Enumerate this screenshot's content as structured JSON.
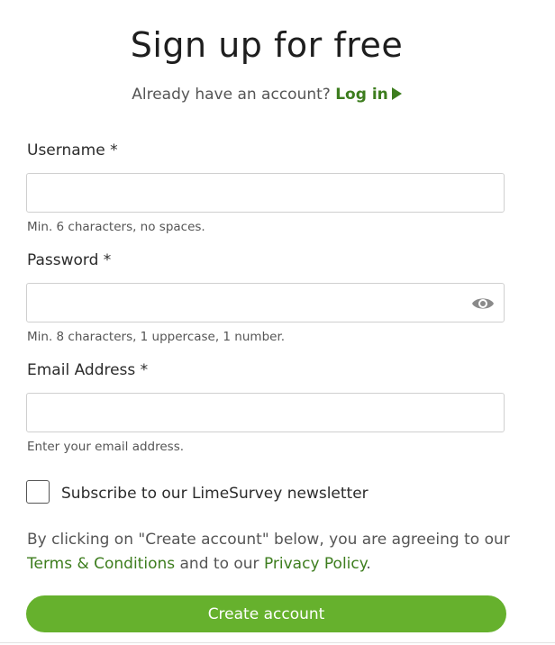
{
  "title": "Sign up for free",
  "login_prompt": {
    "text": "Already have an account?",
    "link_label": "Log in"
  },
  "fields": {
    "username": {
      "label": "Username *",
      "value": "",
      "help": "Min. 6 characters, no spaces."
    },
    "password": {
      "label": "Password *",
      "value": "",
      "help": "Min. 8 characters, 1 uppercase, 1 number.",
      "toggle_icon": "eye-icon"
    },
    "email": {
      "label": "Email Address *",
      "value": "",
      "help": "Enter your email address."
    }
  },
  "newsletter": {
    "label": "Subscribe to our LimeSurvey newsletter",
    "checked": false
  },
  "terms": {
    "prefix": "By clicking on \"Create account\" below, you are agreeing to our",
    "terms_link": "Terms & Conditions",
    "middle": "and to our",
    "privacy_link": "Privacy Policy",
    "suffix": "."
  },
  "submit_label": "Create account",
  "colors": {
    "accent": "#3d7d1e",
    "button": "#66b12d"
  }
}
